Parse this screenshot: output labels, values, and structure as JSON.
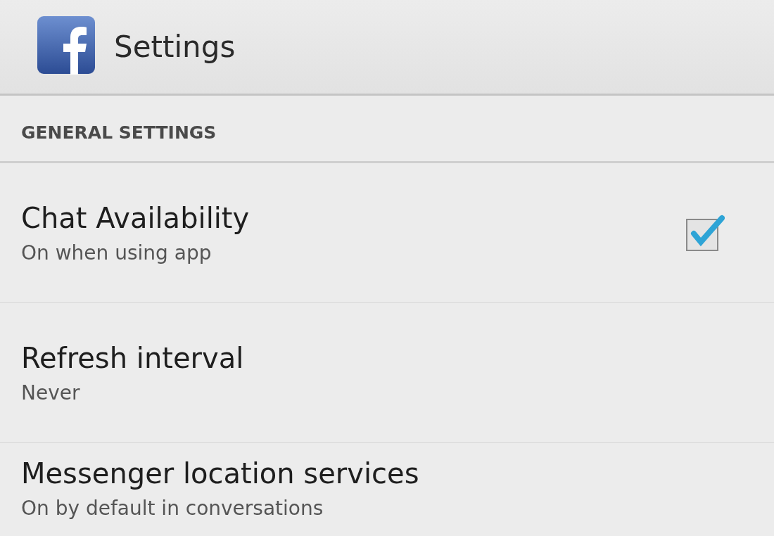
{
  "action_bar": {
    "title": "Settings"
  },
  "section": {
    "title": "GENERAL SETTINGS"
  },
  "settings": [
    {
      "kind": "checkbox",
      "title": "Chat Availability",
      "summary": "On when using app",
      "checked": true
    },
    {
      "kind": "plain",
      "title": "Refresh interval",
      "summary": "Never"
    },
    {
      "kind": "plain",
      "title": "Messenger location services",
      "summary": "On by default in conversations"
    }
  ]
}
